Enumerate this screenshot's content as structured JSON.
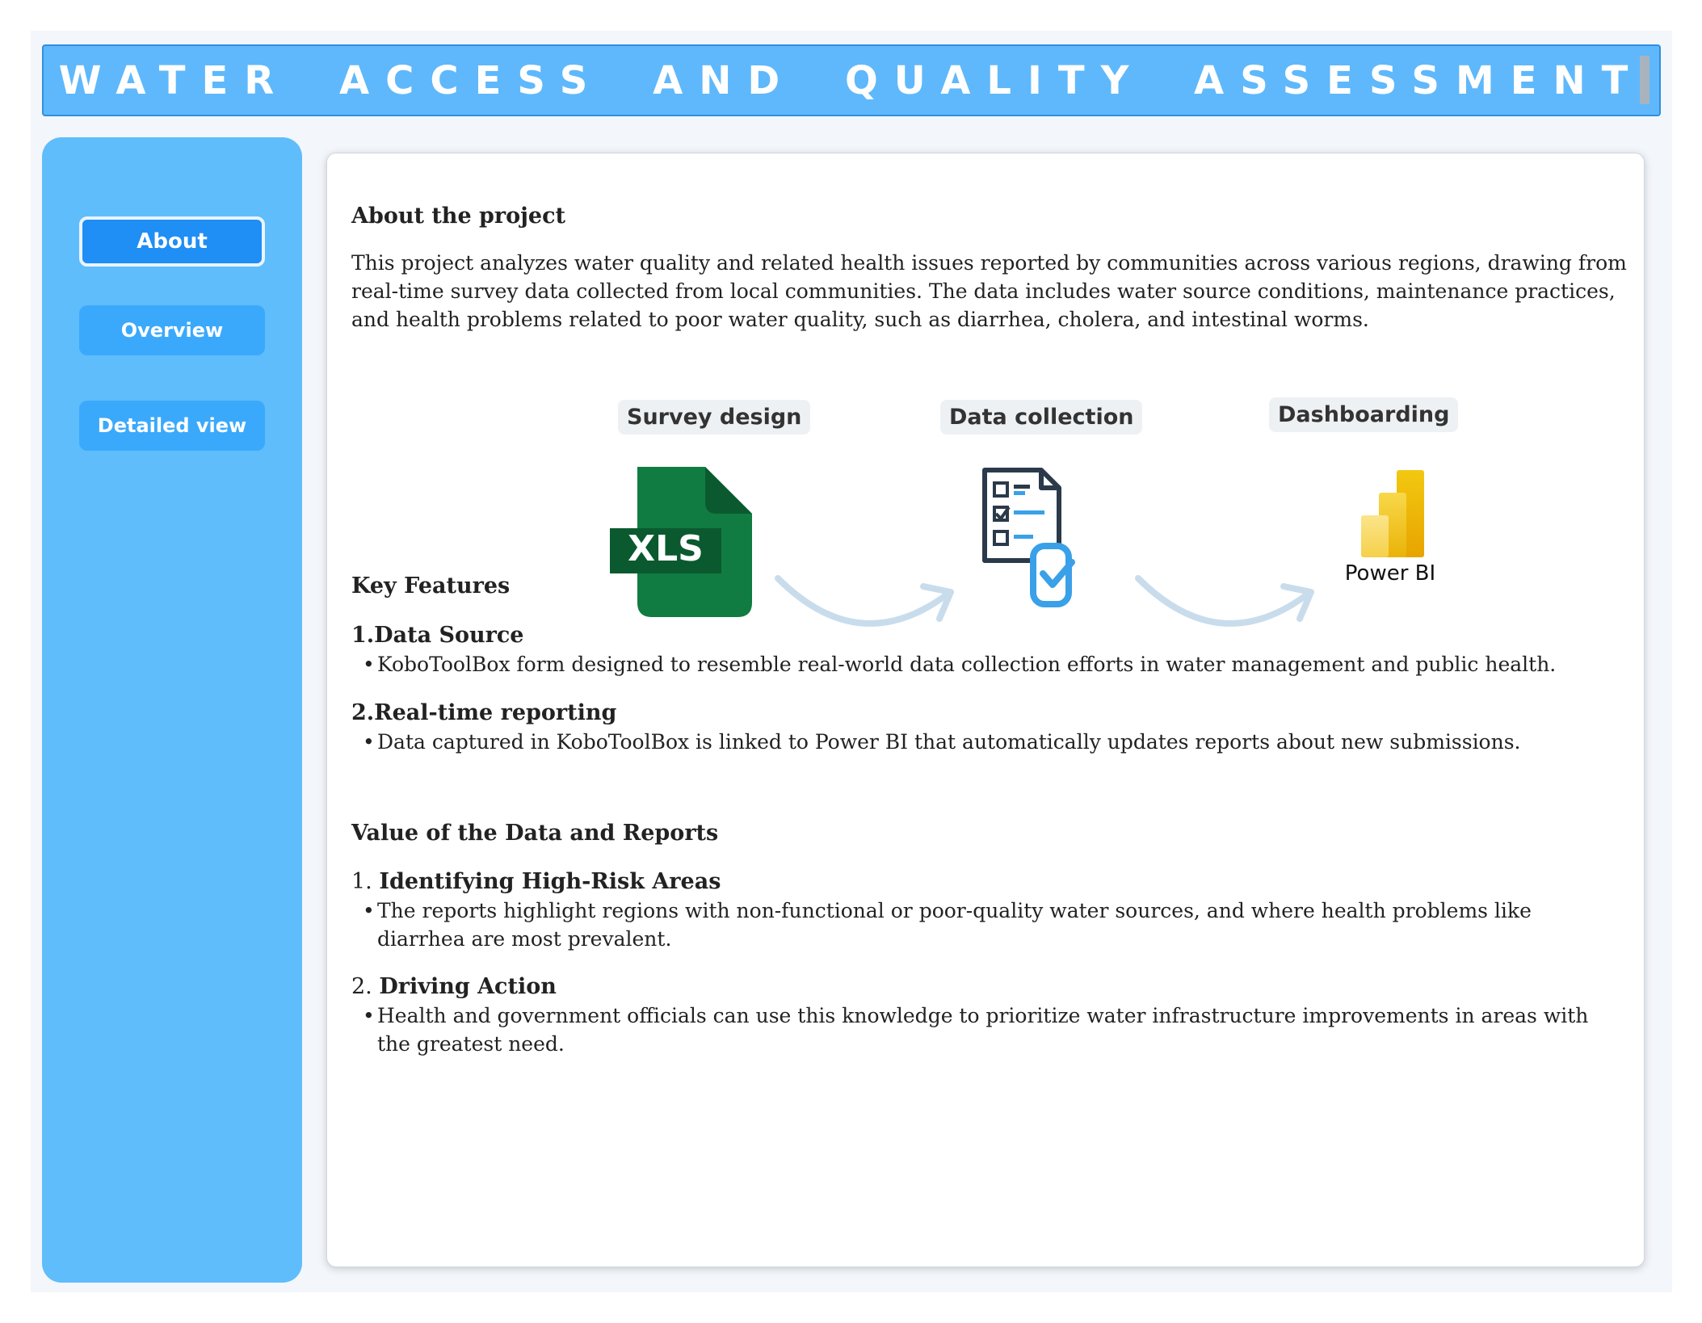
{
  "header": {
    "title": "WATER ACCESS AND QUALITY ASSESSMENT"
  },
  "sidebar": {
    "items": [
      {
        "label": "About",
        "active": true
      },
      {
        "label": "Overview",
        "active": false
      },
      {
        "label": "Detailed view",
        "active": false
      }
    ]
  },
  "about": {
    "heading": "About the project",
    "text": "This project analyzes water quality and related health issues reported by communities across various regions, drawing from real-time survey data collected from local communities. The data includes water source conditions, maintenance practices, and health problems related to poor water quality, such as diarrhea, cholera, and intestinal worms."
  },
  "workflow": {
    "steps": [
      {
        "label": "Survey design",
        "icon": "xls-file-icon",
        "icon_text": "XLS"
      },
      {
        "label": "Data collection",
        "icon": "survey-checklist-icon"
      },
      {
        "label": "Dashboarding",
        "icon": "power-bi-logo",
        "icon_text": "Power BI"
      }
    ]
  },
  "key_features": {
    "heading": "Key Features",
    "items": [
      {
        "title": "1.Data Source",
        "bullet": "KoboToolBox  form designed to resemble real-world data collection efforts in water management and public health."
      },
      {
        "title": "2.Real-time reporting",
        "bullet": "Data captured in KoboToolBox is linked to Power BI that automatically updates reports  about new  submissions."
      }
    ]
  },
  "value": {
    "heading": "Value of the Data and Reports",
    "items": [
      {
        "number": "1.",
        "title": "Identifying High-Risk Areas",
        "bullet": "The reports highlight regions with non-functional or poor-quality water sources, and where health problems like diarrhea are most prevalent."
      },
      {
        "number": "2.",
        "title": "Driving Action",
        "bullet": "Health and government officials can use this knowledge to prioritize water infrastructure improvements in areas with the greatest need."
      }
    ]
  },
  "colors": {
    "header_bg": "#5fb8fb",
    "sidebar_bg": "#5fbdfc",
    "active_button": "#1f8ef5",
    "inactive_button": "#3ba9fb",
    "excel_green": "#107c41",
    "powerbi_yellow": "#f2c811"
  }
}
